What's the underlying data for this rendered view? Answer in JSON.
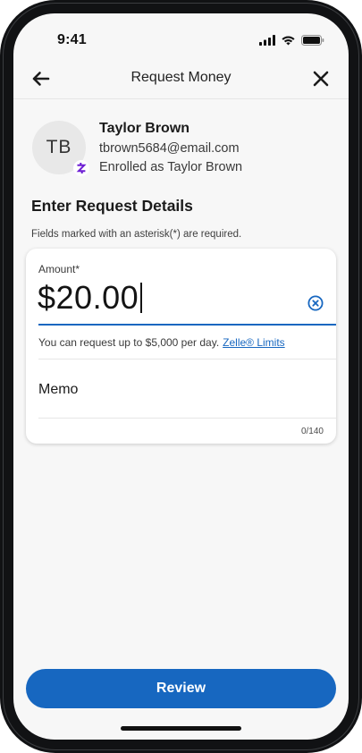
{
  "status_bar": {
    "time": "9:41",
    "icons": [
      "cellular-signal-icon",
      "wifi-icon",
      "battery-icon"
    ]
  },
  "header": {
    "title": "Request Money",
    "back_icon": "arrow-left-icon",
    "close_icon": "close-icon"
  },
  "contact": {
    "initials": "TB",
    "name": "Taylor Brown",
    "email": "tbrown5684@email.com",
    "enrolled": "Enrolled as Taylor Brown",
    "badge_icon": "zelle-z-icon"
  },
  "form": {
    "section_title": "Enter Request Details",
    "required_note": "Fields marked with an asterisk(*) are required.",
    "amount_label": "Amount*",
    "amount_value": "$20.00",
    "limit_text": "You can request up to $5,000 per day.",
    "limit_link": "Zelle® Limits",
    "memo_label": "Memo",
    "memo_count": "0/140"
  },
  "actions": {
    "review_label": "Review"
  },
  "colors": {
    "accent": "#1767c0",
    "zelle_purple": "#6d1ed4",
    "background": "#f7f7f7"
  }
}
